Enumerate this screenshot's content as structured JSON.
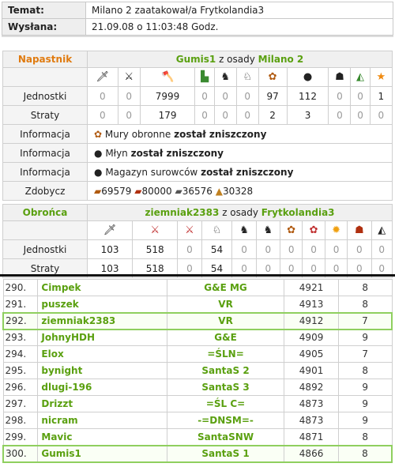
{
  "header": {
    "topic_label": "Temat:",
    "topic_value": "Milano 2 zaatakował/a Frytkolandia3",
    "sent_label": "Wysłana:",
    "sent_value": "21.09.08 o 11:03:48 Godz."
  },
  "attacker": {
    "role": "Napastnik",
    "player": "Gumis1",
    "from_word": "z osady",
    "village": "Milano 2",
    "units_icons": [
      "spear-icon",
      "sword-icon",
      "axe-icon",
      "scout-boot-icon",
      "light-cavalry-icon",
      "heavy-cavalry-icon",
      "ram-icon",
      "catapult-icon",
      "paladin-icon",
      "noble-icon",
      "star-icon"
    ],
    "units_label": "Jednostki",
    "units": [
      "0",
      "0",
      "7999",
      "0",
      "0",
      "0",
      "97",
      "112",
      "0",
      "0",
      "1"
    ],
    "losses_label": "Straty",
    "losses": [
      "0",
      "0",
      "179",
      "0",
      "0",
      "0",
      "2",
      "3",
      "0",
      "0",
      "0"
    ],
    "info_label": "Informacja",
    "info": [
      {
        "icon": "wall-icon",
        "text": "Mury obronne",
        "status": "został zniszczony"
      },
      {
        "icon": "mill-icon",
        "text": "Młyn",
        "status": "został zniszczony"
      },
      {
        "icon": "storage-icon",
        "text": "Magazyn surowców",
        "status": "został zniszczony"
      }
    ],
    "loot_label": "Zdobycz",
    "loot": [
      {
        "icon": "wood-icon",
        "value": "69579"
      },
      {
        "icon": "clay-icon",
        "value": "80000"
      },
      {
        "icon": "iron-icon",
        "value": "36576"
      },
      {
        "icon": "haul-icon",
        "value": "30328"
      }
    ]
  },
  "defender": {
    "role": "Obrońca",
    "player": "ziemniak2383",
    "from_word": "z osady",
    "village": "Frytkolandia3",
    "units_label": "Jednostki",
    "units": [
      "103",
      "518",
      "0",
      "54",
      "0",
      "0",
      "0",
      "0",
      "0",
      "0",
      "0"
    ],
    "losses_label": "Straty",
    "losses": [
      "103",
      "518",
      "0",
      "54",
      "0",
      "0",
      "0",
      "0",
      "0",
      "0",
      "0"
    ]
  },
  "ranking": [
    {
      "pos": "290.",
      "name": "Cimpek",
      "tribe": "G&E MG",
      "points": "4921",
      "villages": "8",
      "highlight": false
    },
    {
      "pos": "291.",
      "name": "puszek",
      "tribe": "VR",
      "points": "4913",
      "villages": "8",
      "highlight": false
    },
    {
      "pos": "292.",
      "name": "ziemniak2383",
      "tribe": "VR",
      "points": "4912",
      "villages": "7",
      "highlight": true
    },
    {
      "pos": "293.",
      "name": "JohnyHDH",
      "tribe": "G&E",
      "points": "4909",
      "villages": "9",
      "highlight": false
    },
    {
      "pos": "294.",
      "name": "Elox",
      "tribe": "=ŚLN=",
      "points": "4905",
      "villages": "7",
      "highlight": false
    },
    {
      "pos": "295.",
      "name": "bynight",
      "tribe": "SantaS 2",
      "points": "4901",
      "villages": "8",
      "highlight": false
    },
    {
      "pos": "296.",
      "name": "dlugi-196",
      "tribe": "SantaS 3",
      "points": "4892",
      "villages": "9",
      "highlight": false
    },
    {
      "pos": "297.",
      "name": "Drizzt",
      "tribe": "=ŚL C=",
      "points": "4873",
      "villages": "9",
      "highlight": false
    },
    {
      "pos": "298.",
      "name": "nicram",
      "tribe": "-=DNSM=-",
      "points": "4873",
      "villages": "9",
      "highlight": false
    },
    {
      "pos": "299.",
      "name": "Mavic",
      "tribe": "SantaSNW",
      "points": "4871",
      "villages": "8",
      "highlight": false
    },
    {
      "pos": "300.",
      "name": "Gumis1",
      "tribe": "SantaS 1",
      "points": "4866",
      "villages": "8",
      "highlight": true
    }
  ]
}
